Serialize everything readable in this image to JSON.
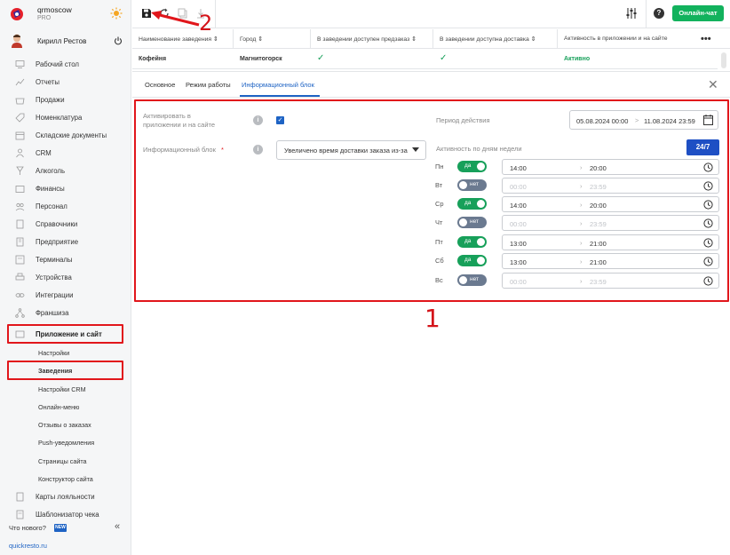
{
  "brand": {
    "name": "qrmoscow",
    "plan": "PRO"
  },
  "user": {
    "name": "Кирилл Рестов"
  },
  "nav": {
    "items": [
      {
        "label": "Рабочий стол",
        "icon": "desktop-icon"
      },
      {
        "label": "Отчеты",
        "icon": "chart-icon"
      },
      {
        "label": "Продажи",
        "icon": "basket-icon"
      },
      {
        "label": "Номенклатура",
        "icon": "tag-icon"
      },
      {
        "label": "Складские документы",
        "icon": "box-icon"
      },
      {
        "label": "CRM",
        "icon": "crm-icon"
      },
      {
        "label": "Алкоголь",
        "icon": "glass-icon"
      },
      {
        "label": "Финансы",
        "icon": "wallet-icon"
      },
      {
        "label": "Персонал",
        "icon": "people-icon"
      },
      {
        "label": "Справочники",
        "icon": "book-icon"
      },
      {
        "label": "Предприятие",
        "icon": "building-icon"
      },
      {
        "label": "Терминалы",
        "icon": "terminal-icon"
      },
      {
        "label": "Устройства",
        "icon": "printer-icon"
      },
      {
        "label": "Интеграции",
        "icon": "link-icon"
      },
      {
        "label": "Франшиза",
        "icon": "network-icon"
      },
      {
        "label": "Приложение и сайт",
        "icon": "app-icon",
        "active": true
      }
    ],
    "sub_items": [
      {
        "label": "Настройки"
      },
      {
        "label": "Заведения",
        "active": true
      },
      {
        "label": "Настройки CRM"
      },
      {
        "label": "Онлайн-меню"
      },
      {
        "label": "Отзывы о заказах"
      },
      {
        "label": "Push-уведомления"
      },
      {
        "label": "Страницы сайта"
      },
      {
        "label": "Конструктор сайта"
      }
    ],
    "bottom_items": [
      {
        "label": "Карты лояльности",
        "icon": "card-icon"
      },
      {
        "label": "Шаблонизатор чека",
        "icon": "receipt-icon"
      }
    ],
    "whats_new": "Что нового?",
    "new_badge": "NEW",
    "collapse": "«",
    "site_link": "quickresto.ru"
  },
  "toolbar": {
    "help": "?",
    "chat_button": "Онлайн-чат"
  },
  "table": {
    "headers": [
      "Наименование заведения ⇕",
      "Город ⇕",
      "В заведении доступен предзаказ ⇕",
      "В заведении доступна доставка ⇕",
      "Активность в приложении и на сайте"
    ],
    "row": {
      "name": "Кофейня",
      "city": "Магнитогорск",
      "preorder": "✓",
      "delivery": "✓",
      "activity": "Активно"
    },
    "more": "•••"
  },
  "tabs": [
    {
      "label": "Основное"
    },
    {
      "label": "Режим работы"
    },
    {
      "label": "Информационный блок",
      "active": true
    }
  ],
  "form": {
    "activate_label_1": "Активировать в",
    "activate_label_2": "приложении и на сайте",
    "activate_checked": true,
    "info_block_label": "Информационный блок",
    "required_mark": "*",
    "info_block_value": "Увеличено время доставки заказа из-за",
    "period_label": "Период действия",
    "period_from": "05.08.2024 00:00",
    "period_sep": ">",
    "period_to": "11.08.2024 23:59",
    "weekly_label": "Активность по дням недели",
    "btn_247": "24/7"
  },
  "days": [
    {
      "day": "Пн",
      "on": true,
      "toggle": "да",
      "from": "14:00",
      "to": "20:00"
    },
    {
      "day": "Вт",
      "on": false,
      "toggle": "нет",
      "from": "00:00",
      "to": "23:59"
    },
    {
      "day": "Ср",
      "on": true,
      "toggle": "да",
      "from": "14:00",
      "to": "20:00"
    },
    {
      "day": "Чт",
      "on": false,
      "toggle": "нет",
      "from": "00:00",
      "to": "23:59"
    },
    {
      "day": "Пт",
      "on": true,
      "toggle": "да",
      "from": "13:00",
      "to": "21:00"
    },
    {
      "day": "Сб",
      "on": true,
      "toggle": "да",
      "from": "13:00",
      "to": "21:00"
    },
    {
      "day": "Вс",
      "on": false,
      "toggle": "нет",
      "from": "00:00",
      "to": "23:59"
    }
  ],
  "annotations": {
    "one": "1",
    "two": "2"
  },
  "colors": {
    "accent": "#1e63c4",
    "success": "#17a05a",
    "annotation": "#e1161b",
    "chat": "#12b25d"
  }
}
